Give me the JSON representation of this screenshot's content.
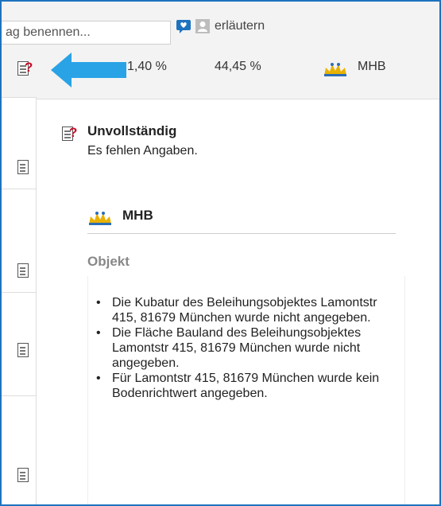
{
  "toolbar": {
    "name_input_value": "ag benennen...",
    "explain_link": "erläutern",
    "icons": [
      "comment-icon",
      "person-icon"
    ]
  },
  "summary_row": {
    "value_a": "1,40 %",
    "value_b": "44,45 %",
    "bank_name": "MHB",
    "status_icon": "incomplete-document-icon"
  },
  "popover": {
    "title": "Unvollständig",
    "subtitle": "Es fehlen Angaben.",
    "bank_name": "MHB",
    "section_heading": "Objekt",
    "messages": [
      "Die Kubatur des Beleihungsobjektes Lamontstr 415, 81679 München wurde nicht angegeben.",
      "Die Fläche Bauland des Beleihungsobjektes Lamontstr 415, 81679 München wurde nicht angegeben.",
      "Für Lamontstr 415, 81679 München wurde kein Bodenrichtwert angegeben."
    ]
  },
  "colors": {
    "frame": "#1e73be",
    "arrow": "#29a3e6",
    "alert": "#c8102e",
    "muted_heading": "#888888"
  }
}
